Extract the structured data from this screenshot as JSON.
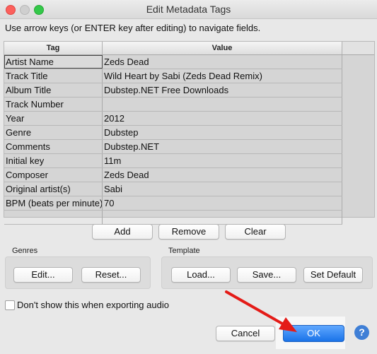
{
  "window": {
    "title": "Edit Metadata Tags"
  },
  "instruction": "Use arrow keys (or ENTER key after editing) to navigate fields.",
  "table": {
    "headers": {
      "tag": "Tag",
      "value": "Value"
    },
    "rows": [
      {
        "tag": "Artist Name",
        "value": "Zeds Dead"
      },
      {
        "tag": "Track Title",
        "value": "Wild Heart by Sabi (Zeds Dead Remix)"
      },
      {
        "tag": "Album Title",
        "value": "Dubstep.NET Free Downloads"
      },
      {
        "tag": "Track Number",
        "value": ""
      },
      {
        "tag": "Year",
        "value": "2012"
      },
      {
        "tag": "Genre",
        "value": "Dubstep"
      },
      {
        "tag": "Comments",
        "value": "Dubstep.NET"
      },
      {
        "tag": "Initial key",
        "value": "11m"
      },
      {
        "tag": "Composer",
        "value": "Zeds Dead"
      },
      {
        "tag": "Original artist(s)",
        "value": "Sabi"
      },
      {
        "tag": "BPM (beats per minute)",
        "value": "70"
      },
      {
        "tag": "",
        "value": ""
      }
    ]
  },
  "row_actions": {
    "add": "Add",
    "remove": "Remove",
    "clear": "Clear"
  },
  "genres": {
    "label": "Genres",
    "edit": "Edit...",
    "reset": "Reset..."
  },
  "template": {
    "label": "Template",
    "load": "Load...",
    "save": "Save...",
    "set_default": "Set Default"
  },
  "options": {
    "dont_show_label": "Don't show this when exporting audio",
    "dont_show_checked": false
  },
  "footer": {
    "cancel": "Cancel",
    "ok": "OK",
    "help": "?"
  },
  "colors": {
    "ok_button": "#1a73e8",
    "arrow": "#e41b17",
    "help_button": "#3f7fd6"
  }
}
